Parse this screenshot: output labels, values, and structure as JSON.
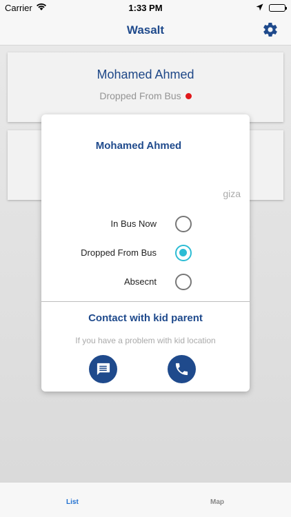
{
  "status_bar": {
    "carrier": "Carrier",
    "time": "1:33 PM"
  },
  "nav": {
    "title": "Wasalt",
    "settings_icon": "gear-icon"
  },
  "cards": [
    {
      "name": "Mohamed Ahmed",
      "status": "Dropped From Bus",
      "status_color": "#e8191c"
    }
  ],
  "modal": {
    "kid_name": "Mohamed Ahmed",
    "kid_area": "giza",
    "options": [
      {
        "label": "In Bus Now",
        "selected": false
      },
      {
        "label": "Dropped From Bus",
        "selected": true
      },
      {
        "label": "Absecnt",
        "selected": false
      }
    ],
    "contact_title": "Contact with kid parent",
    "contact_hint": "If you have a problem with kid location",
    "message_icon": "message-icon",
    "call_icon": "phone-icon"
  },
  "tabs": [
    {
      "label": "List",
      "active": true
    },
    {
      "label": "Map",
      "active": false
    }
  ],
  "colors": {
    "brand": "#1f4a8c",
    "accent": "#2cbcd4",
    "tab_active": "#1f6fd0"
  }
}
